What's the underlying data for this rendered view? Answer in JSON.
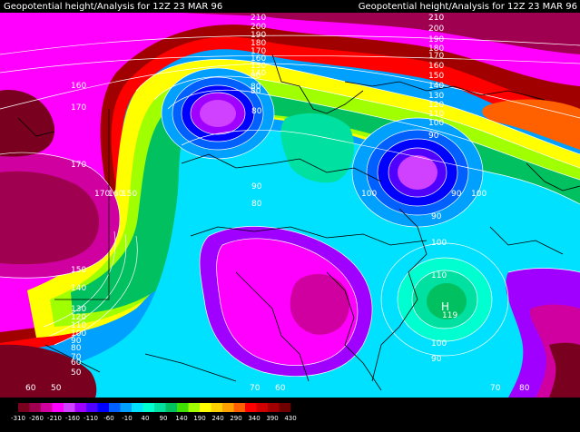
{
  "header": {
    "title_left": "Geopotential height/Analysis for 12Z 23 MAR 96",
    "title_right": "Geopotential height/Analysis for 12Z 23 MAR 96"
  },
  "palette": [
    "#7a0020",
    "#a00050",
    "#d000a0",
    "#ff00ff",
    "#d040ff",
    "#a000ff",
    "#5000ff",
    "#0000ff",
    "#0060ff",
    "#00a0ff",
    "#00e0ff",
    "#00ffd0",
    "#00e0a0",
    "#00c060",
    "#40e000",
    "#a0ff00",
    "#ffff00",
    "#ffd000",
    "#ffa000",
    "#ff6000",
    "#ff0000",
    "#d00000",
    "#a00000",
    "#700000"
  ],
  "legend": {
    "ticks": [
      "-310",
      "-260",
      "-210",
      "-160",
      "-110",
      "-60",
      "-10",
      "40",
      "90",
      "140",
      "190",
      "240",
      "290",
      "340",
      "390",
      "430"
    ]
  },
  "contour_labels": [
    {
      "id": "l210",
      "text": "210"
    },
    {
      "id": "l200a",
      "text": "200"
    },
    {
      "id": "l190a",
      "text": "190"
    },
    {
      "id": "l180a",
      "text": "180"
    },
    {
      "id": "l170a",
      "text": "170"
    },
    {
      "id": "l160a",
      "text": "160"
    },
    {
      "id": "l150a",
      "text": "150"
    },
    {
      "id": "l140a",
      "text": "140"
    },
    {
      "id": "l210r",
      "text": "210"
    },
    {
      "id": "l200r",
      "text": "200"
    },
    {
      "id": "l190r",
      "text": "190"
    },
    {
      "id": "l180r",
      "text": "180"
    },
    {
      "id": "l170r",
      "text": "170"
    },
    {
      "id": "l160r",
      "text": "160"
    },
    {
      "id": "l150r",
      "text": "150"
    },
    {
      "id": "l140r",
      "text": "140"
    },
    {
      "id": "l130r",
      "text": "130"
    },
    {
      "id": "l120r",
      "text": "120"
    },
    {
      "id": "l110r",
      "text": "110"
    },
    {
      "id": "l100r",
      "text": "100"
    },
    {
      "id": "l90r",
      "text": "90"
    },
    {
      "id": "l160w",
      "text": "160"
    },
    {
      "id": "l170w",
      "text": "170"
    },
    {
      "id": "l170w2",
      "text": "170"
    },
    {
      "id": "l170m",
      "text": "170"
    },
    {
      "id": "l160m",
      "text": "160"
    },
    {
      "id": "l150m",
      "text": "150"
    },
    {
      "id": "l150w",
      "text": "150"
    },
    {
      "id": "l140w",
      "text": "140"
    },
    {
      "id": "l130w",
      "text": "130"
    },
    {
      "id": "l120w",
      "text": "120"
    },
    {
      "id": "l110w",
      "text": "110"
    },
    {
      "id": "l100w",
      "text": "100"
    },
    {
      "id": "l90w",
      "text": "90"
    },
    {
      "id": "l80w",
      "text": "80"
    },
    {
      "id": "l70w",
      "text": "70"
    },
    {
      "id": "l60w",
      "text": "60"
    },
    {
      "id": "l50w",
      "text": "50"
    },
    {
      "id": "l60b",
      "text": "60"
    },
    {
      "id": "l50b",
      "text": "50"
    },
    {
      "id": "l80c",
      "text": "80"
    },
    {
      "id": "l90c",
      "text": "90"
    },
    {
      "id": "l80d",
      "text": "80"
    },
    {
      "id": "l80e",
      "text": "80"
    },
    {
      "id": "l90e",
      "text": "90"
    },
    {
      "id": "l80f",
      "text": "80"
    },
    {
      "id": "l100f",
      "text": "100"
    },
    {
      "id": "l90g",
      "text": "90"
    },
    {
      "id": "l100g",
      "text": "100"
    },
    {
      "id": "l90h",
      "text": "90"
    },
    {
      "id": "l100h",
      "text": "100"
    },
    {
      "id": "l110h",
      "text": "110"
    },
    {
      "id": "l119h",
      "text": "119"
    },
    {
      "id": "l100i",
      "text": "100"
    },
    {
      "id": "l90i",
      "text": "90"
    },
    {
      "id": "l70b",
      "text": "70"
    },
    {
      "id": "l60c",
      "text": "60"
    },
    {
      "id": "l70c",
      "text": "70"
    },
    {
      "id": "l80g",
      "text": "80"
    }
  ],
  "high_marker": "H"
}
